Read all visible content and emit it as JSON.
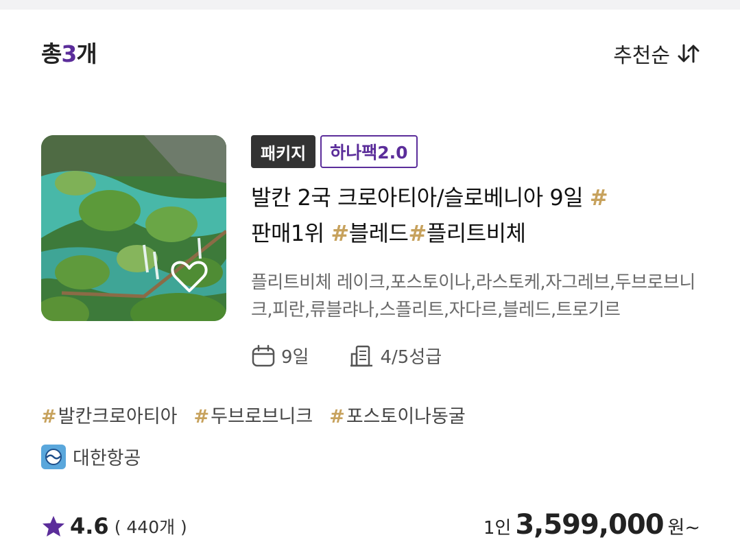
{
  "header": {
    "count_prefix": "총",
    "count_number": "3",
    "count_suffix": "개",
    "sort_label": "추천순"
  },
  "product": {
    "badges": {
      "type": "패키지",
      "brand": "하나팩2.0"
    },
    "title_line1": "발칸 2국 크로아티아/슬로베니아 9일 ",
    "title_hash1": "#",
    "title_line2_a": "판매1위 ",
    "title_hash2": "#",
    "title_tag2": "블레드",
    "title_hash3": "#",
    "title_tag3": "플리트비체",
    "description": "플리트비체 레이크,포스토이나,라스토케,자그레브,두브로브니크,피란,류블랴나,스플리트,자다르,블레드,트로기르",
    "duration": "9일",
    "hotel_grade": "4/5성급",
    "hashtags": [
      {
        "hash": "#",
        "text": "발칸크로아티아"
      },
      {
        "hash": "#",
        "text": "두브로브니크"
      },
      {
        "hash": "#",
        "text": "포스토이나동굴"
      }
    ],
    "airline": "대한항공",
    "rating": "4.6",
    "review_count": "( 440개 )",
    "price_per": "1인",
    "price_amount": "3,599,000",
    "price_unit": "원~"
  },
  "colors": {
    "accent": "#5b2d9a",
    "hashtag": "#c7a25d",
    "badge_dark": "#333333"
  },
  "icons": [
    "sort-icon",
    "heart-icon",
    "calendar-icon",
    "hotel-icon",
    "airline-logo-icon",
    "star-icon"
  ]
}
